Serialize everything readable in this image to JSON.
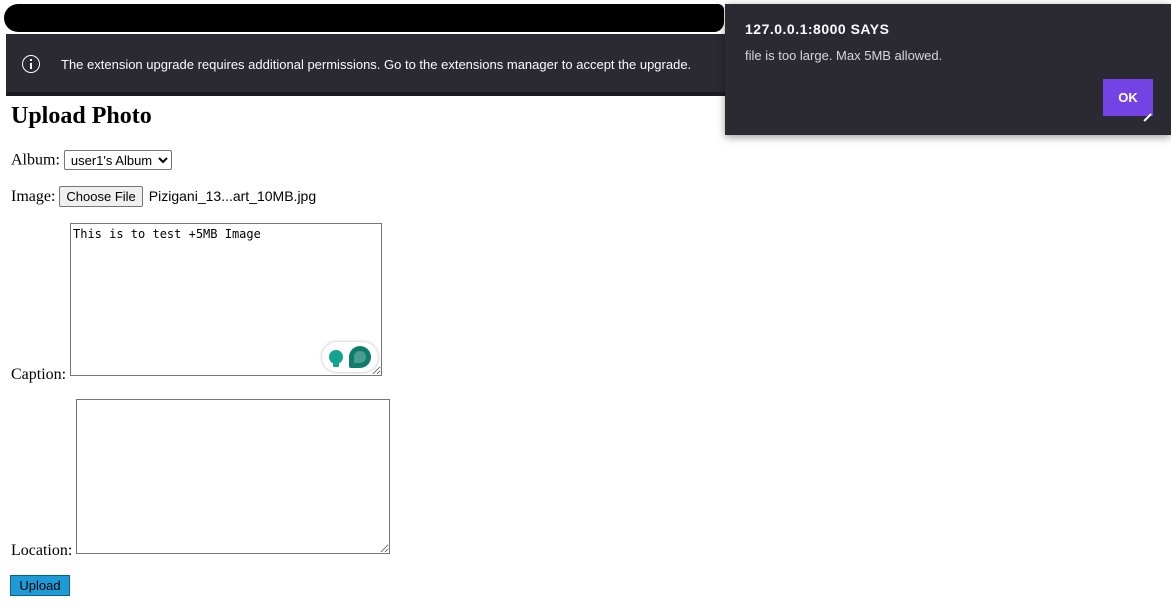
{
  "extension_banner": {
    "message": "The extension upgrade requires additional permissions. Go to the extensions manager to accept the upgrade."
  },
  "alert": {
    "title": "127.0.0.1:8000 SAYS",
    "message": "file is too large. Max 5MB allowed.",
    "ok_label": "OK",
    "accent_color": "#7542e5"
  },
  "page": {
    "title": "Upload Photo"
  },
  "form": {
    "album_label": "Album:",
    "album_selected": "user1's Album",
    "image_label": "Image:",
    "choose_file_label": "Choose File",
    "file_name": "Pizigani_13...art_10MB.jpg",
    "caption_label": "Caption:",
    "caption_value": "This is to test +5MB Image",
    "location_label": "Location:",
    "location_value": "",
    "upload_label": "Upload",
    "upload_color": "#1e9ad6"
  }
}
